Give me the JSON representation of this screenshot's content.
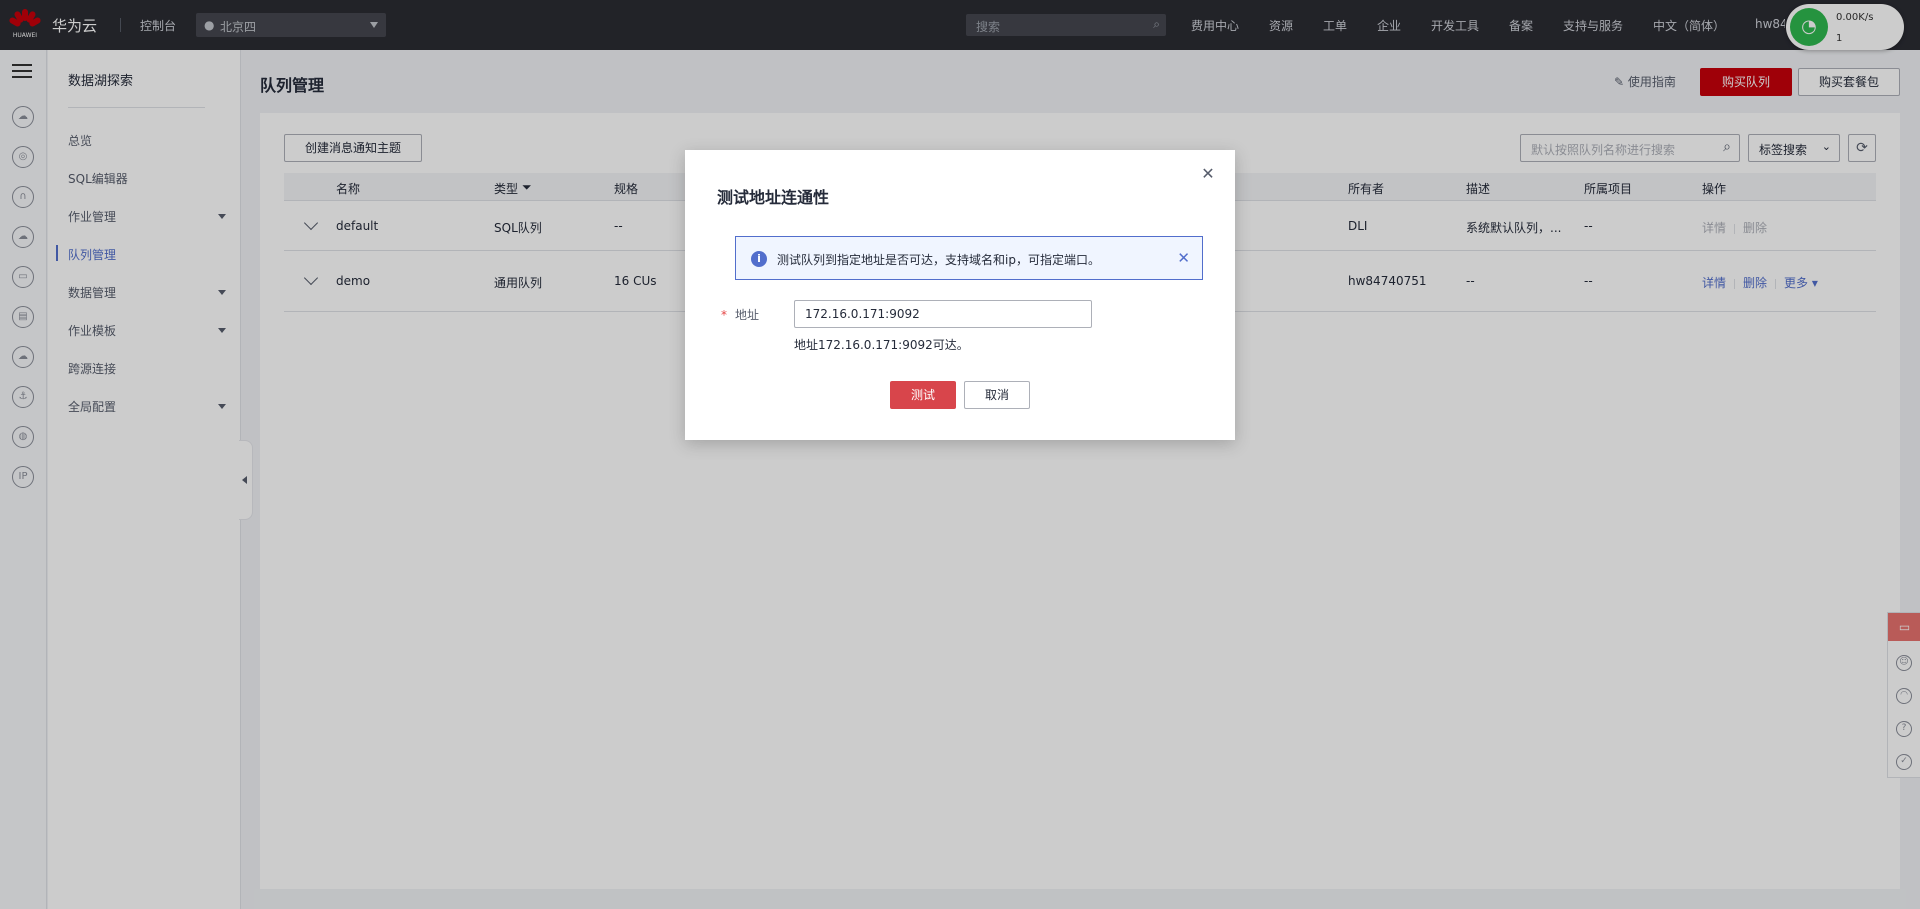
{
  "topbar": {
    "logo_text": "HUAWEI",
    "brand": "华为云",
    "console": "控制台",
    "region": "北京四",
    "search_placeholder": "搜索",
    "nav": [
      "费用中心",
      "资源",
      "工单",
      "企业",
      "开发工具",
      "备案",
      "支持与服务",
      "中文（简体）"
    ],
    "account": "hw84",
    "net_speed": "0.00K/s",
    "net_count": "1"
  },
  "sidenav": {
    "title": "数据湖探索",
    "items": [
      {
        "label": "总览"
      },
      {
        "label": "SQL编辑器"
      },
      {
        "label": "作业管理"
      },
      {
        "label": "队列管理"
      },
      {
        "label": "数据管理"
      },
      {
        "label": "作业模板"
      },
      {
        "label": "跨源连接"
      },
      {
        "label": "全局配置"
      }
    ]
  },
  "page": {
    "title": "队列管理",
    "guide": "使用指南",
    "buy_queue": "购买队列",
    "buy_package": "购买套餐包",
    "create_topic": "创建消息通知主题",
    "search_placeholder": "默认按照队列名称进行搜索",
    "tag_search": "标签搜索"
  },
  "table": {
    "headers": {
      "name": "名称",
      "type": "类型",
      "spec": "规格",
      "owner": "所有者",
      "desc": "描述",
      "project": "所属项目",
      "ops": "操作"
    },
    "rows": [
      {
        "name": "default",
        "type": "SQL队列",
        "spec": "--",
        "owner": "DLI",
        "desc": "系统默认队列，...",
        "project": "--",
        "op_detail": "详情",
        "op_delete": "删除"
      },
      {
        "name": "demo",
        "type": "通用队列",
        "spec": "16 CUs",
        "owner": "hw84740751",
        "desc": "--",
        "project": "--",
        "op_detail": "详情",
        "op_delete": "删除",
        "op_more": "更多"
      }
    ]
  },
  "dialog": {
    "title": "测试地址连通性",
    "alert": "测试队列到指定地址是否可达，支持域名和ip，可指定端口。",
    "required_mark": "*",
    "address_label": "地址",
    "address_value": "172.16.0.171:9092",
    "result": "地址172.16.0.171:9092可达。",
    "test_button": "测试",
    "cancel_button": "取消"
  },
  "colors": {
    "brand_red": "#c7000b",
    "primary_blue": "#526ecc",
    "test_button": "#d8454b"
  }
}
